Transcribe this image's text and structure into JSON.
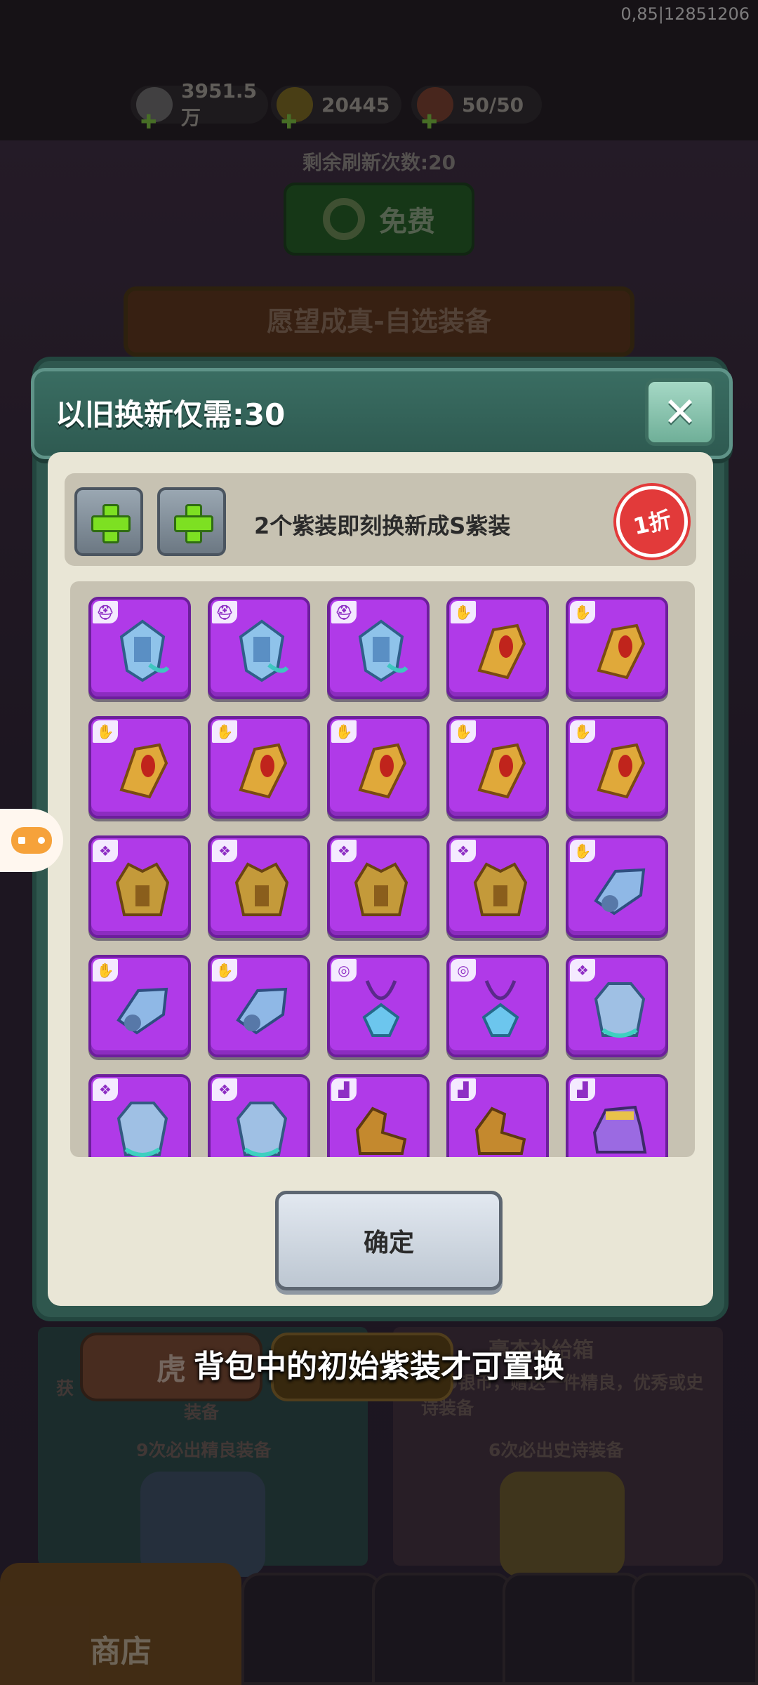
{
  "status": {
    "debug": "0,85|12851206"
  },
  "resources": [
    {
      "icon": "silver-coin-icon",
      "value": "3951.5万"
    },
    {
      "icon": "gold-ingot-icon",
      "value": "20445"
    },
    {
      "icon": "meat-stamina-icon",
      "value": "50/50"
    }
  ],
  "background": {
    "refresh_label": "剩余刷新次数:20",
    "free_button": "免费",
    "banner_title": "愿望成真-自选装备",
    "left_chip": "虎",
    "right_title": "豪杰补给箱",
    "right_desc": "300银币，赠送一件精良，优秀或史诗装备",
    "left_desc_prefix": "获",
    "left_desc_suffix": "装备",
    "left_guarantee": "9次必出精良装备",
    "right_guarantee": "6次必出史诗装备",
    "shop_tab": "商店"
  },
  "modal": {
    "title": "以旧换新仅需:30",
    "close_icon": "close-icon",
    "exchange_text": "2个紫装即刻换新成S紫装",
    "discount_badge": "1折",
    "confirm_button": "确定"
  },
  "items": [
    {
      "slot": "helmet-slot-icon",
      "art": "blue-mech-helmet-icon"
    },
    {
      "slot": "helmet-slot-icon",
      "art": "blue-mech-helmet-icon"
    },
    {
      "slot": "helmet-slot-icon",
      "art": "blue-mech-helmet-icon"
    },
    {
      "slot": "gauntlet-slot-icon",
      "art": "golden-gauntlet-icon"
    },
    {
      "slot": "gauntlet-slot-icon",
      "art": "golden-gauntlet-icon"
    },
    {
      "slot": "gauntlet-slot-icon",
      "art": "golden-gauntlet-icon"
    },
    {
      "slot": "gauntlet-slot-icon",
      "art": "golden-gauntlet-icon"
    },
    {
      "slot": "gauntlet-slot-icon",
      "art": "golden-gauntlet-icon"
    },
    {
      "slot": "gauntlet-slot-icon",
      "art": "golden-gauntlet-icon"
    },
    {
      "slot": "gauntlet-slot-icon",
      "art": "golden-gauntlet-icon"
    },
    {
      "slot": "armor-slot-icon",
      "art": "golden-armor-icon"
    },
    {
      "slot": "armor-slot-icon",
      "art": "golden-armor-icon"
    },
    {
      "slot": "armor-slot-icon",
      "art": "golden-armor-icon"
    },
    {
      "slot": "armor-slot-icon",
      "art": "golden-armor-icon"
    },
    {
      "slot": "gauntlet-slot-icon",
      "art": "blue-gauntlet-icon"
    },
    {
      "slot": "gauntlet-slot-icon",
      "art": "blue-gauntlet-icon"
    },
    {
      "slot": "gauntlet-slot-icon",
      "art": "blue-gauntlet-icon"
    },
    {
      "slot": "necklace-slot-icon",
      "art": "blue-necklace-icon"
    },
    {
      "slot": "necklace-slot-icon",
      "art": "blue-necklace-icon"
    },
    {
      "slot": "armor-slot-icon",
      "art": "blue-armor-icon"
    },
    {
      "slot": "armor-slot-icon",
      "art": "blue-armor-icon"
    },
    {
      "slot": "armor-slot-icon",
      "art": "blue-armor-icon"
    },
    {
      "slot": "boots-slot-icon",
      "art": "golden-boots-icon"
    },
    {
      "slot": "boots-slot-icon",
      "art": "golden-boots-icon"
    },
    {
      "slot": "boots-slot-icon",
      "art": "purple-boots-icon"
    }
  ],
  "toast": "背包中的初始紫装才可置换",
  "colors": {
    "purple_item": "#b03ae8",
    "modal_green": "#2f574e",
    "panel_beige": "#e9e6d6",
    "discount_red": "#e23a3a",
    "plus_green": "#7de022"
  }
}
